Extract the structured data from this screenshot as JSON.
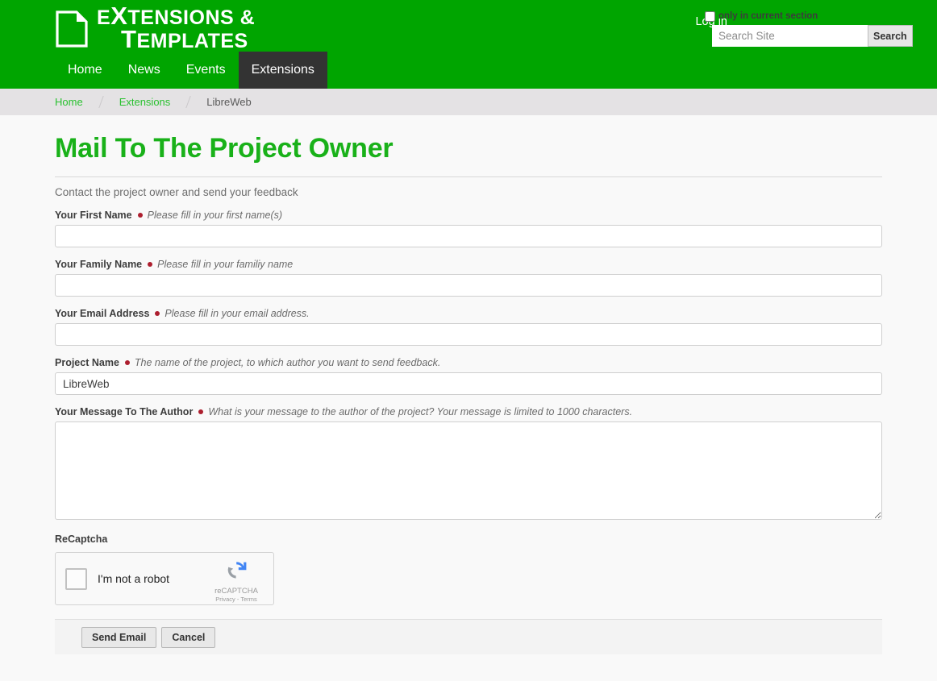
{
  "header": {
    "logo": {
      "icon": "document-icon",
      "line1_prefix": "E",
      "line1_x": "X",
      "line1_rest": "TENSIONS &",
      "line2_t": "T",
      "line2_rest": "EMPLATES"
    },
    "login_label": "Log in",
    "search": {
      "section_checkbox_label": "only in current section",
      "placeholder": "Search Site",
      "value": "",
      "button_label": "Search"
    }
  },
  "nav": {
    "items": [
      {
        "label": "Home",
        "active": false
      },
      {
        "label": "News",
        "active": false
      },
      {
        "label": "Events",
        "active": false
      },
      {
        "label": "Extensions",
        "active": true
      }
    ]
  },
  "breadcrumb": {
    "items": [
      {
        "label": "Home",
        "current": false
      },
      {
        "label": "Extensions",
        "current": false
      },
      {
        "label": "LibreWeb",
        "current": true
      }
    ]
  },
  "page": {
    "title": "Mail To The Project Owner",
    "description": "Contact the project owner and send your feedback"
  },
  "form": {
    "fields": [
      {
        "label": "Your First Name",
        "required": true,
        "help": "Please fill in your first name(s)",
        "value": "",
        "type": "text"
      },
      {
        "label": "Your Family Name",
        "required": true,
        "help": "Please fill in your familiy name",
        "value": "",
        "type": "text"
      },
      {
        "label": "Your Email Address",
        "required": true,
        "help": "Please fill in your email address.",
        "value": "",
        "type": "text"
      },
      {
        "label": "Project Name",
        "required": true,
        "help": "The name of the project, to which author you want to send feedback.",
        "value": "LibreWeb",
        "type": "text"
      },
      {
        "label": "Your Message To The Author",
        "required": true,
        "help": "What is your message to the author of the project? Your message is limited to 1000 characters.",
        "value": "",
        "type": "textarea"
      }
    ],
    "captcha": {
      "label": "ReCaptcha",
      "checkbox_label": "I'm not a robot",
      "brand_name": "reCAPTCHA",
      "terms": "Privacy - Terms"
    },
    "actions": {
      "submit_label": "Send Email",
      "cancel_label": "Cancel"
    }
  },
  "colors": {
    "brand_green": "#00a500",
    "title_green": "#19b119",
    "link_green": "#29c12f",
    "nav_active": "#333333",
    "required_dot": "#ad1f2f",
    "breadcrumb_bg": "#e4e2e4",
    "content_bg": "#f9f9f9"
  }
}
